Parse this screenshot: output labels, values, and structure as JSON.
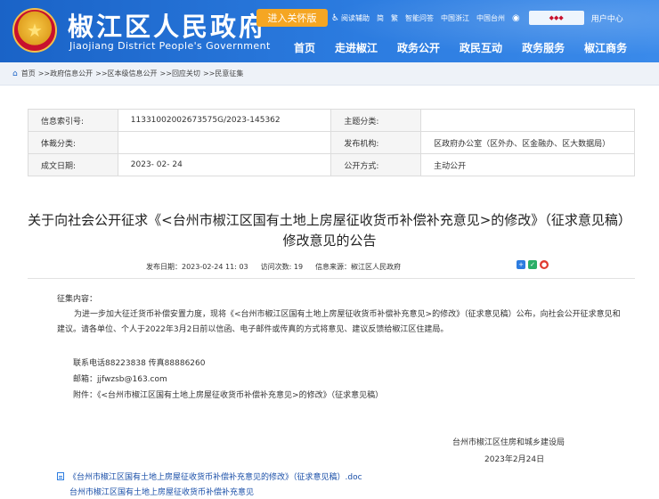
{
  "header": {
    "title": "椒江区人民政府",
    "subtitle": "Jiaojiang District People's Government",
    "care_button": "进入关怀版",
    "top_links": [
      "阅读辅助",
      "简",
      "繁",
      "智能问答",
      "中国浙江",
      "中国台州"
    ],
    "user_center": "用户中心",
    "nav": [
      "首页",
      "走进椒江",
      "政务公开",
      "政民互动",
      "政务服务",
      "椒江商务"
    ]
  },
  "breadcrumb": [
    "首页",
    ">>政府信息公开",
    ">>区本级信息公开",
    ">>回应关切",
    ">>民意征集"
  ],
  "info": {
    "index_label": "信息索引号:",
    "index_value": "11331002002673575G/2023-145362",
    "topic_label": "主题分类:",
    "topic_value": "",
    "genre_label": "体裁分类:",
    "genre_value": "",
    "publisher_label": "发布机构:",
    "publisher_value": "区政府办公室（区外办、区金融办、区大数据局）",
    "date_label": "成文日期:",
    "date_value": "2023- 02- 24",
    "method_label": "公开方式:",
    "method_value": "主动公开"
  },
  "article": {
    "title_line1": "关于向社会公开征求《<台州市椒江区国有土地上房屋征收货币补偿补充意见>的修改》（征求意见稿）",
    "title_line2": "修改意见的公告",
    "publish_date": "发布日期：2023-02-24 11: 03",
    "views": "访问次数: 19",
    "source": "信息来源：椒江区人民政府",
    "section_label": "征集内容：",
    "paragraph": "为进一步加大征迁货币补偿安置力度，现将《<台州市椒江区国有土地上房屋征收货币补偿补充意见>的修改》（征求意见稿）公布，向社会公开征求意见和建议。请各单位、个人于2022年3月2日前以信函、电子邮件或传真的方式将意见、建议反馈给椒江区住建局。",
    "contact_phone": "联系电话88223838   传真88886260",
    "email": "邮箱：jjfwzsb@163.com",
    "attachment_line": "附件：《<台州市椒江区国有土地上房屋征收货币补偿补充意见>的修改》（征求意见稿）",
    "sign_org": "台州市椒江区住房和城乡建设局",
    "sign_date": "2023年2月24日",
    "attachment_link": "《台州市椒江区国有土地上房屋征收货币补偿补充意见的修改》（征求意见稿）.doc",
    "attachment_link2": "台州市椒江区国有土地上房屋征收货币补偿补充意见"
  }
}
